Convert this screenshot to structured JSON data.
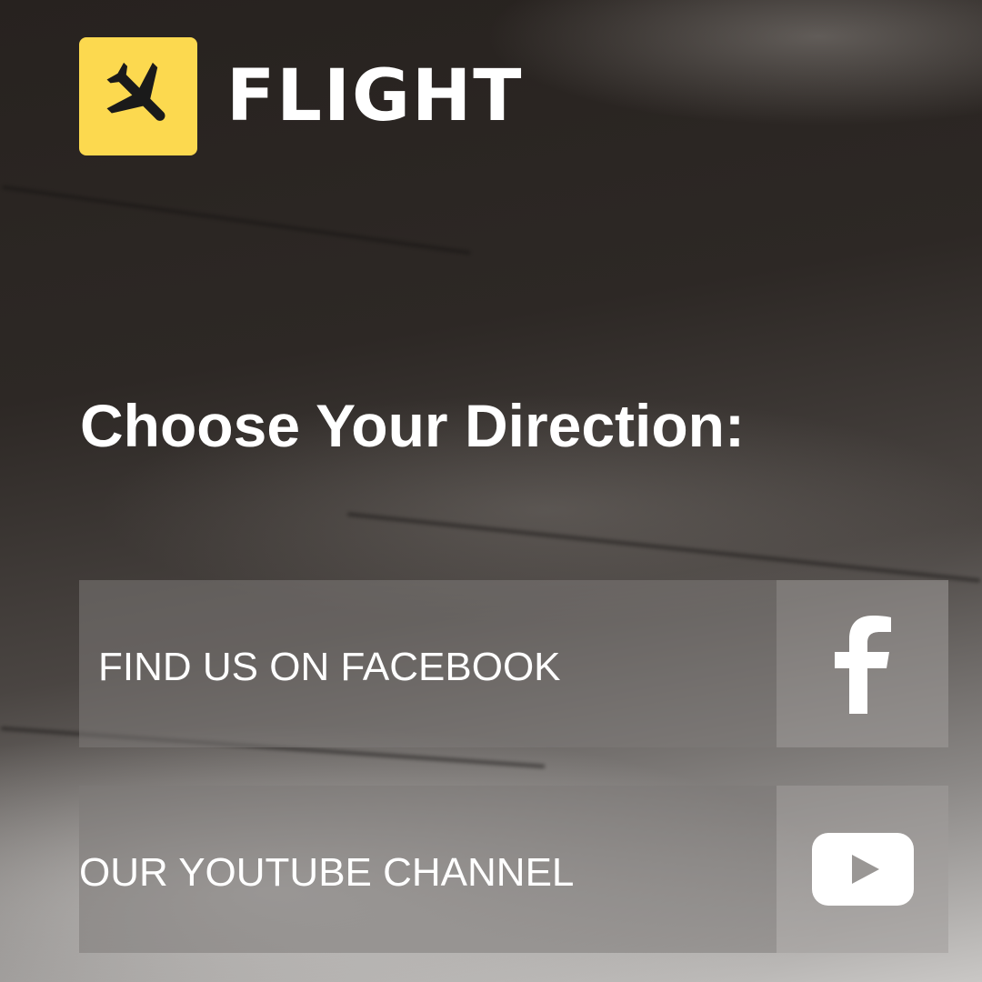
{
  "brand": {
    "name": "FLIGHT",
    "logo_icon": "airplane-icon",
    "logo_color": "#fcd94f"
  },
  "heading": "Choose Your Direction:",
  "links": [
    {
      "label": "FIND US ON FACEBOOK",
      "icon": "facebook-icon"
    },
    {
      "label": "OUR YOUTUBE CHANNEL",
      "icon": "youtube-icon"
    }
  ]
}
